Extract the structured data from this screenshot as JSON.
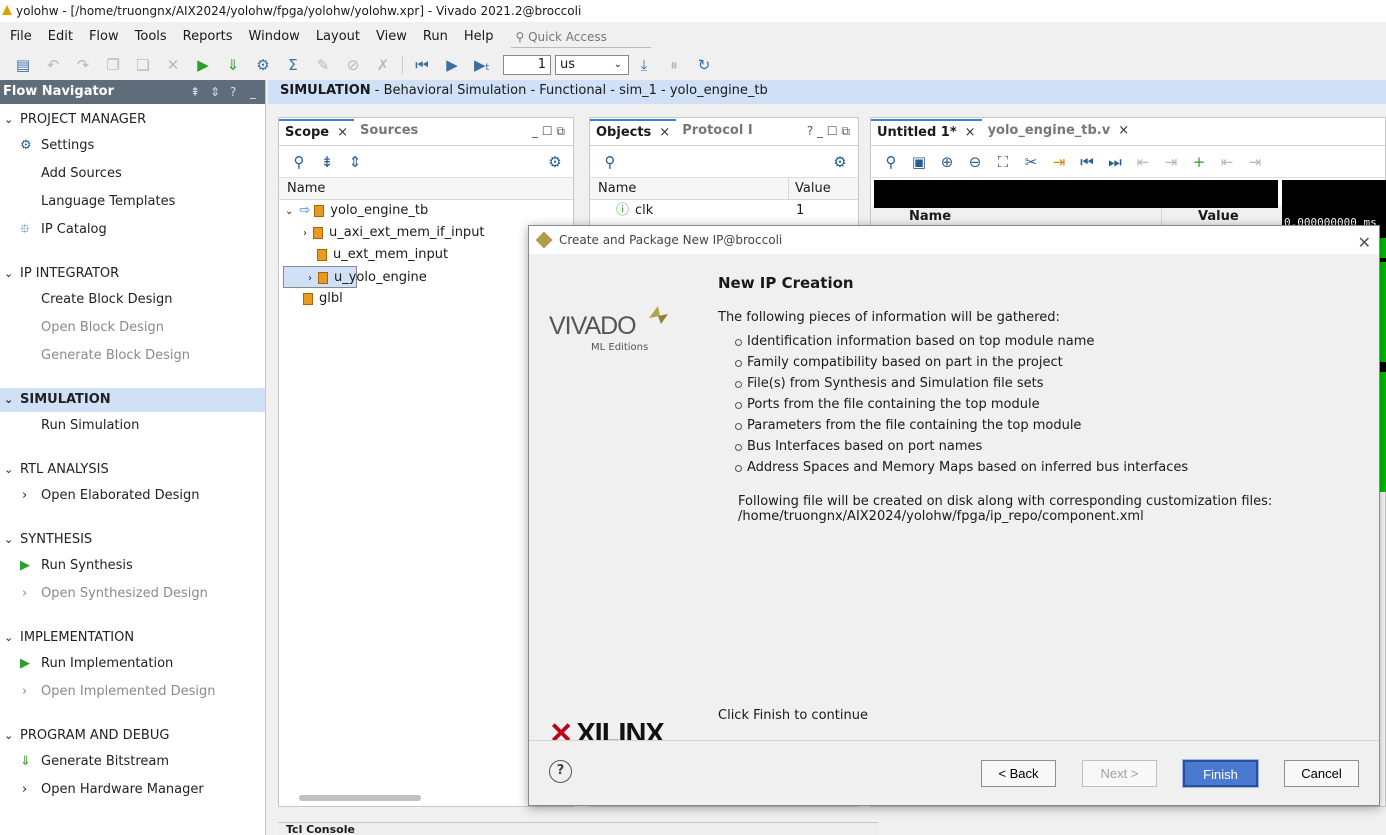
{
  "window": {
    "title": "yolohw - [/home/truongnx/AIX2024/yolohw/fpga/yolohw/yolohw.xpr] - Vivado 2021.2@broccoli"
  },
  "menu": [
    "File",
    "Edit",
    "Flow",
    "Tools",
    "Reports",
    "Window",
    "Layout",
    "View",
    "Run",
    "Help"
  ],
  "quick_access": {
    "placeholder": "Quick Access"
  },
  "toolbar": {
    "run_time_value": "1",
    "run_time_unit": "us"
  },
  "flow_navigator": {
    "title": "Flow Navigator",
    "sections": [
      {
        "label": "PROJECT MANAGER",
        "items": [
          {
            "label": "Settings",
            "icon": "gear-icon"
          },
          {
            "label": "Add Sources"
          },
          {
            "label": "Language Templates"
          },
          {
            "label": "IP Catalog",
            "icon": "ip-catalog-icon"
          }
        ]
      },
      {
        "label": "IP INTEGRATOR",
        "items": [
          {
            "label": "Create Block Design"
          },
          {
            "label": "Open Block Design",
            "disabled": true
          },
          {
            "label": "Generate Block Design",
            "disabled": true
          }
        ]
      },
      {
        "label": "SIMULATION",
        "active": true,
        "items": [
          {
            "label": "Run Simulation"
          }
        ]
      },
      {
        "label": "RTL ANALYSIS",
        "items": [
          {
            "label": "Open Elaborated Design"
          }
        ]
      },
      {
        "label": "SYNTHESIS",
        "items": [
          {
            "label": "Run Synthesis",
            "icon": "play-icon"
          },
          {
            "label": "Open Synthesized Design",
            "disabled": true
          }
        ]
      },
      {
        "label": "IMPLEMENTATION",
        "items": [
          {
            "label": "Run Implementation",
            "icon": "play-icon"
          },
          {
            "label": "Open Implemented Design",
            "disabled": true
          }
        ]
      },
      {
        "label": "PROGRAM AND DEBUG",
        "items": [
          {
            "label": "Generate Bitstream",
            "icon": "bitstream-icon"
          },
          {
            "label": "Open Hardware Manager"
          }
        ]
      }
    ]
  },
  "sim_header": {
    "bold": "SIMULATION",
    "rest": " - Behavioral Simulation - Functional - sim_1 - yolo_engine_tb"
  },
  "scope_panel": {
    "tabs": [
      "Scope",
      "Sources"
    ],
    "col_name": "Name",
    "rows": [
      {
        "label": "yolo_engine_tb",
        "level": 0
      },
      {
        "label": "u_axi_ext_mem_if_input",
        "level": 1
      },
      {
        "label": "u_ext_mem_input",
        "level": 1
      },
      {
        "label": "u_yolo_engine",
        "level": 1
      },
      {
        "label": "glbl",
        "level": 0
      }
    ]
  },
  "objects_panel": {
    "tabs": [
      "Objects",
      "Protocol I"
    ],
    "col_name": "Name",
    "col_value": "Value",
    "rows": [
      {
        "name": "clk",
        "value": "1"
      }
    ]
  },
  "wave_panel": {
    "tabs": [
      "Untitled 1*",
      "yolo_engine_tb.v"
    ],
    "col_name": "Name",
    "col_value": "Value",
    "time_label": "0.000000000 ms"
  },
  "dialog": {
    "title": "Create and Package New IP@broccoli",
    "brand_top": "VIVADO",
    "brand_sub": "ML Editions",
    "brand_bottom": "XILINX",
    "heading": "New IP Creation",
    "intro": "The following pieces of information will be gathered:",
    "bullets": [
      "Identification information based on top module name",
      "Family compatibility based on part in the project",
      "File(s) from Synthesis and Simulation file sets",
      "Ports from the file containing the top module",
      "Parameters from the file containing the top module",
      "Bus Interfaces based on port names",
      "Address Spaces and Memory Maps based on inferred bus interfaces"
    ],
    "file_note": "Following file will be created on disk along with corresponding customization files:",
    "file_path": "/home/truongnx/AIX2024/yolohw/fpga/ip_repo/component.xml",
    "finish_note": "Click Finish to continue",
    "back_label": "< Back",
    "next_label": "Next >",
    "finish_label": "Finish",
    "cancel_label": "Cancel"
  },
  "tcl_bar": {
    "tab": "Tcl Console"
  }
}
